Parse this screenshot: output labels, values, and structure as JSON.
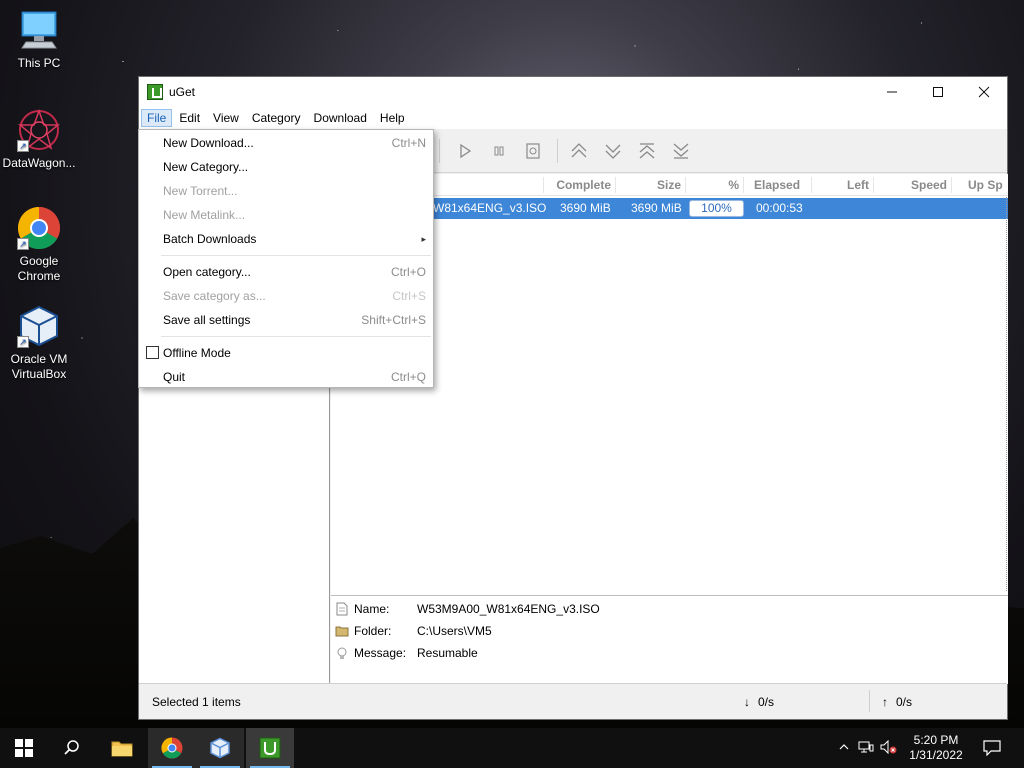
{
  "desktop": {
    "icons": [
      {
        "label": "This PC",
        "icon": "computer-icon"
      },
      {
        "label": "DataWagon...",
        "icon": "datawagon-icon"
      },
      {
        "label": "Google Chrome",
        "icon": "chrome-icon"
      },
      {
        "label": "Oracle VM VirtualBox",
        "icon": "virtualbox-icon"
      }
    ]
  },
  "window": {
    "title": "uGet",
    "controls": {
      "minimize": "—",
      "maximize": "☐",
      "close": "✕"
    },
    "menus": [
      "File",
      "Edit",
      "View",
      "Category",
      "Download",
      "Help"
    ],
    "active_menu": "File"
  },
  "toolbar": {
    "icons": [
      "start-icon",
      "pause-icon",
      "properties-icon",
      "move-top-icon",
      "move-down-icon",
      "move-up-icon",
      "move-bottom-icon"
    ]
  },
  "file_menu": {
    "items": [
      {
        "label": "New Download...",
        "shortcut": "Ctrl+N",
        "enabled": true
      },
      {
        "label": "New Category...",
        "shortcut": "",
        "enabled": true
      },
      {
        "label": "New Torrent...",
        "shortcut": "",
        "enabled": false
      },
      {
        "label": "New Metalink...",
        "shortcut": "",
        "enabled": false
      },
      {
        "label": "Batch Downloads",
        "shortcut": "▸",
        "enabled": true,
        "submenu": true
      },
      {
        "label": "Open category...",
        "shortcut": "Ctrl+O",
        "enabled": true
      },
      {
        "label": "Save category as...",
        "shortcut": "Ctrl+S",
        "enabled": false
      },
      {
        "label": "Save all settings",
        "shortcut": "Shift+Ctrl+S",
        "enabled": true
      },
      {
        "label": "Offline Mode",
        "shortcut": "",
        "enabled": true,
        "checkbox": true,
        "checked": false
      },
      {
        "label": "Quit",
        "shortcut": "Ctrl+Q",
        "enabled": true
      }
    ]
  },
  "download_list": {
    "columns": [
      "Complete",
      "Size",
      "%",
      "Elapsed",
      "Left",
      "Speed",
      "Up Sp"
    ],
    "rows": [
      {
        "name": "W81x64ENG_v3.ISO",
        "complete": "3690 MiB",
        "size": "3690 MiB",
        "percent": "100%",
        "elapsed": "00:00:53",
        "left": "",
        "speed": ""
      }
    ]
  },
  "details": {
    "name_label": "Name:",
    "name_value": "W53M9A00_W81x64ENG_v3.ISO",
    "folder_label": "Folder:",
    "folder_value": "C:\\Users\\VM5",
    "message_label": "Message:",
    "message_value": "Resumable"
  },
  "status": {
    "selected": "Selected 1 items",
    "down_speed": "0/s",
    "up_speed": "0/s",
    "down_arrow": "↓",
    "up_arrow": "↑"
  },
  "taskbar": {
    "time": "5:20 PM",
    "date": "1/31/2022",
    "pinned": [
      "start-icon",
      "search-icon",
      "file-explorer-icon",
      "chrome-icon",
      "virtualbox-icon",
      "uget-icon"
    ]
  },
  "colors": {
    "selection": "#3d86d8",
    "menu_active": "#dce9f8",
    "taskbar": "#101010"
  }
}
